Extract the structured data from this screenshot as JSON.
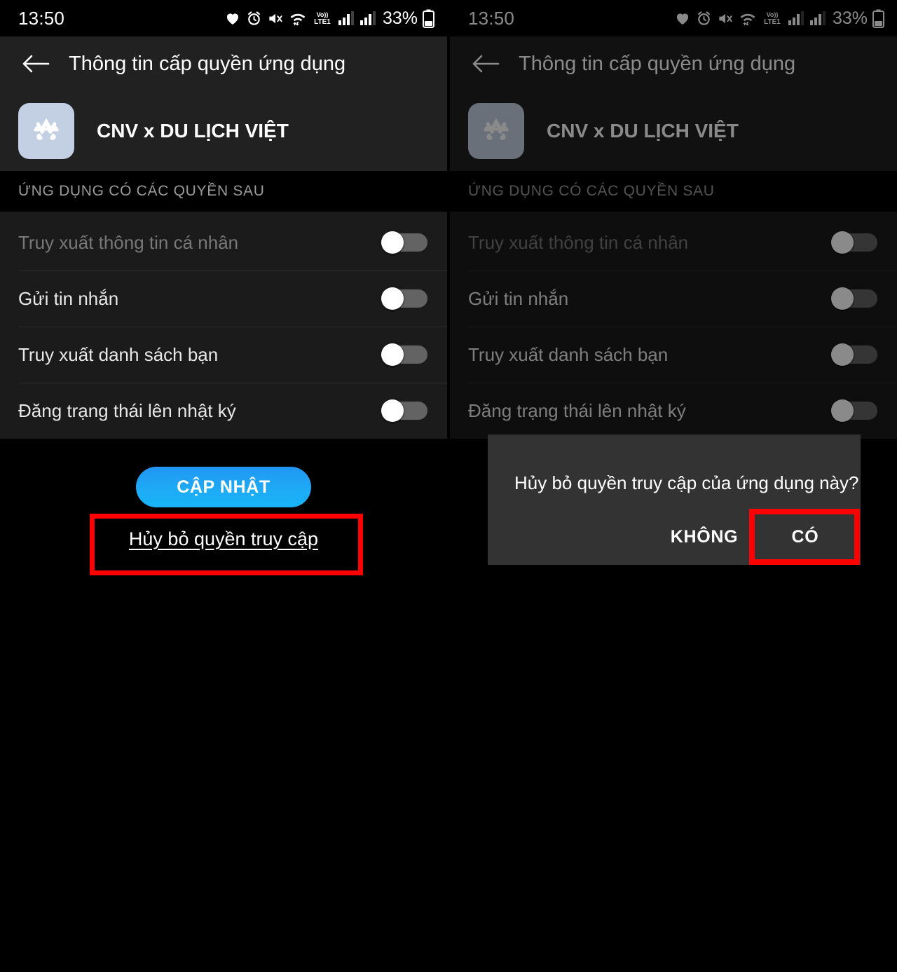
{
  "statusbar": {
    "time": "13:50",
    "battery_percent": "33%",
    "icons": [
      "heart-icon",
      "alarm-clock-icon",
      "mute-vibrate-icon",
      "wifi-icon",
      "volte1-icon",
      "signal-bars-sim1-icon",
      "signal-bars-sim2-icon"
    ]
  },
  "appbar": {
    "title": "Thông tin cấp quyền ứng dụng",
    "back_icon": "back-arrow-icon"
  },
  "app": {
    "name": "CNV x DU LỊCH VIỆT",
    "icon": "app-store-icon"
  },
  "section": {
    "header": "ỨNG DỤNG CÓ CÁC QUYỀN SAU"
  },
  "permissions": [
    {
      "label": "Truy xuất thông tin cá nhân",
      "state": "off",
      "dimmed": true
    },
    {
      "label": "Gửi tin nhắn",
      "state": "off",
      "dimmed": false
    },
    {
      "label": "Truy xuất danh sách bạn",
      "state": "off",
      "dimmed": false
    },
    {
      "label": "Đăng trạng thái lên nhật ký",
      "state": "off",
      "dimmed": false
    }
  ],
  "actions": {
    "update_button": "CẬP NHẬT",
    "revoke_link": "Hủy bỏ quyền truy cập"
  },
  "dialog": {
    "message": "Hủy bỏ quyền truy cập của ứng dụng này?",
    "no_label": "KHÔNG",
    "yes_label": "CÓ"
  },
  "colors": {
    "accent_blue": "#1eaaf5",
    "annotation_red": "#ff0000",
    "appbar_background": "#212121",
    "list_background": "#1b1b1b",
    "dialog_background": "#333333",
    "page_background": "#000000"
  }
}
